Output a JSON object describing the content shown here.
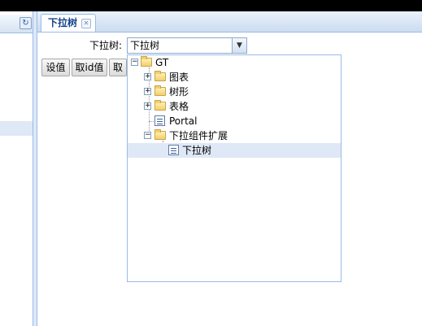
{
  "main": {
    "tab": {
      "label": "下拉树",
      "close_icon": "close-icon"
    },
    "field": {
      "label": "下拉树:",
      "value": "下拉树"
    },
    "buttons": [
      {
        "label": "设值"
      },
      {
        "label": "取id值"
      },
      {
        "label": "取"
      }
    ]
  },
  "left": {
    "refresh_icon": "refresh-icon"
  },
  "tree": {
    "nodes": [
      {
        "label": "GT",
        "type": "folder",
        "state": "expanded"
      },
      {
        "label": "图表",
        "type": "folder",
        "state": "collapsed"
      },
      {
        "label": "树形",
        "type": "folder",
        "state": "collapsed"
      },
      {
        "label": "表格",
        "type": "folder",
        "state": "collapsed"
      },
      {
        "label": "Portal",
        "type": "leaf"
      },
      {
        "label": "下拉组件扩展",
        "type": "folder",
        "state": "expanded"
      },
      {
        "label": "下拉树",
        "type": "leaf",
        "selected": true
      }
    ]
  },
  "colors": {
    "accent": "#15428b",
    "border": "#99bbe8",
    "selection": "#dfe8f6"
  }
}
